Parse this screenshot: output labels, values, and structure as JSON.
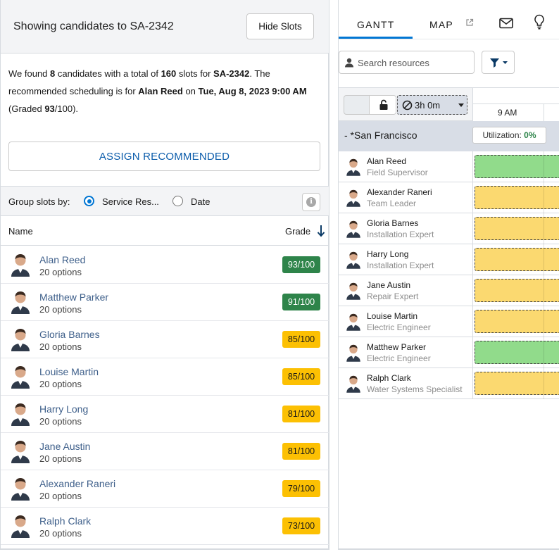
{
  "header": {
    "title": "Showing candidates to SA-2342",
    "hide_slots_label": "Hide Slots"
  },
  "summary": {
    "p1": "We found ",
    "count": "8",
    "p2": " candidates with a total of ",
    "slots": "160",
    "p3": " slots for ",
    "appointment": "SA-2342",
    "p4": ". The recommended scheduling is for ",
    "resource": "Alan Reed",
    "p5": " on ",
    "datetime": "Tue, Aug 8, 2023 9:00 AM",
    "p6": " (Graded ",
    "grade": "93",
    "p7": "/100)."
  },
  "assign_label": "ASSIGN RECOMMENDED",
  "group": {
    "label": "Group slots by:",
    "option_resource": "Service Res...",
    "option_date": "Date",
    "selected": "resource"
  },
  "list_header": {
    "name": "Name",
    "grade": "Grade"
  },
  "candidates": [
    {
      "name": "Alan Reed",
      "options": "20 options",
      "grade": "93/100",
      "grade_color": "green"
    },
    {
      "name": "Matthew Parker",
      "options": "20 options",
      "grade": "91/100",
      "grade_color": "green"
    },
    {
      "name": "Gloria Barnes",
      "options": "20 options",
      "grade": "85/100",
      "grade_color": "yellow"
    },
    {
      "name": "Louise Martin",
      "options": "20 options",
      "grade": "85/100",
      "grade_color": "yellow"
    },
    {
      "name": "Harry Long",
      "options": "20 options",
      "grade": "81/100",
      "grade_color": "yellow"
    },
    {
      "name": "Jane Austin",
      "options": "20 options",
      "grade": "81/100",
      "grade_color": "yellow"
    },
    {
      "name": "Alexander Raneri",
      "options": "20 options",
      "grade": "79/100",
      "grade_color": "yellow"
    },
    {
      "name": "Ralph Clark",
      "options": "20 options",
      "grade": "73/100",
      "grade_color": "yellow"
    }
  ],
  "tabs": {
    "gantt": "GANTT",
    "map": "MAP"
  },
  "search": {
    "placeholder": "Search resources"
  },
  "gantt": {
    "duration": "3h 0m",
    "time_label": "9 AM",
    "territory": "- *San Francisco",
    "utilization_label": "Utilization: ",
    "utilization_value": "0%",
    "resources": [
      {
        "name": "Alan Reed",
        "role": "Field Supervisor",
        "slot": "green"
      },
      {
        "name": "Alexander Raneri",
        "role": "Team Leader",
        "slot": "yellow"
      },
      {
        "name": "Gloria Barnes",
        "role": "Installation Expert",
        "slot": "yellow"
      },
      {
        "name": "Harry Long",
        "role": "Installation Expert",
        "slot": "yellow"
      },
      {
        "name": "Jane Austin",
        "role": "Repair Expert",
        "slot": "yellow"
      },
      {
        "name": "Louise Martin",
        "role": "Electric Engineer",
        "slot": "yellow"
      },
      {
        "name": "Matthew Parker",
        "role": "Electric Engineer",
        "slot": "green"
      },
      {
        "name": "Ralph Clark",
        "role": "Water Systems Specialist",
        "slot": "yellow"
      }
    ]
  },
  "colors": {
    "accent": "#0176d3",
    "grade_green": "#2e844a",
    "grade_yellow": "#fcc003",
    "slot_green": "#91db8b",
    "slot_yellow": "#fbd970"
  }
}
